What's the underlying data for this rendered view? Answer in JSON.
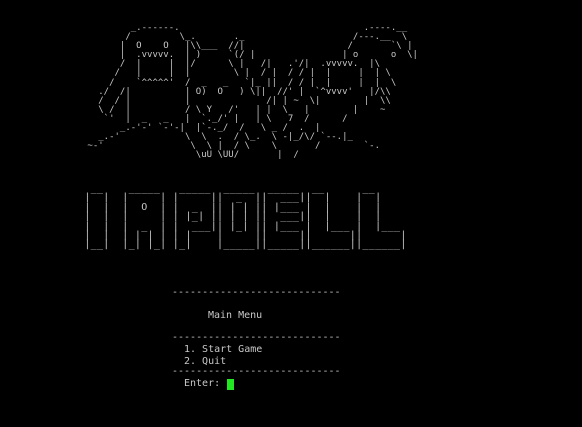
{
  "terminal": {
    "monsters_art": "         _.------.                                  .----.__\n        /         \\_.       ._                    /---.__  \\\n       |  O    O   |\\\\___  //|                   /       `\\ |\n       |  .vvvvv.  | )     `(/ |                | o      o  \\|\n       /  |     |  |/      \\ |   /|   .'/|  .vvvvv.  |\\\n      /   |     |  |        \\ |  / |  / / |  |     |  | \\\n     /    `^^^^^'  /  _   _   `|_ ||  / / |  |     |  |  \\\n   ./  /|          | O)  O   ) \\||  //' |  `^vvvv'   |/\\\\\n   /  / |          |              /| | ~  \\|        |  \\\\\n   \\ /  |          / \\ Y   /'   | |  \\   |        |    ~\n    `'  |  _   _   |  `._/' |   | \\   7  /      /\n       _.-'-' `-'-|  |`-._/  /   \\ _ /  .  |\n   _.-'            \\  \\  .  / \\_.  \\ -|_/\\/ `--.|_\n ~-'                \\  \\ |  / \\    \\       /        `-.\n                     \\uU \\UU/       |  /",
    "title_art": "  __    _____   _____  _____  _____  __      __\n |  |  |     | |     ||  _  ||  ___||  |    |  |\n |  |  |  O  | |  _  || | | || |___ |  |    |  |\n |  |  |     | | |_| || | | ||  ___||  |    |  |\n |  |  |  _  | |  ___|| |_| || |___ |  |___ |  |___\n |  |  | | | | | |    |     ||     ||      ||      |\n |__|  |_| |_| |_|    |_____||_____||______||______|",
    "menu": {
      "separator": "----------------------------",
      "title": "Main Menu",
      "options": [
        "1. Start Game",
        "2. Quit"
      ],
      "prompt": "Enter:"
    },
    "colors": {
      "background": "#000000",
      "text": "#c8c8c8",
      "cursor": "#22e822"
    }
  }
}
